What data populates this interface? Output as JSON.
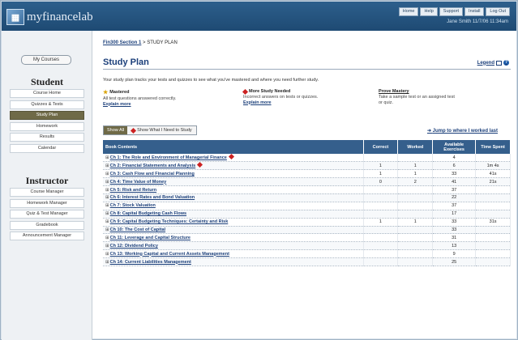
{
  "app": {
    "logo_text": "myfinancelab",
    "top_nav": [
      "Home",
      "Help",
      "Support",
      "Install",
      "Log Out"
    ],
    "user_line": "Jane Smith 11/7/06 11:34am"
  },
  "sidebar": {
    "my_courses": "My Courses",
    "student_heading": "Student",
    "student_items": [
      {
        "label": "Course Home",
        "active": false
      },
      {
        "label": "Quizzes & Tests",
        "active": false
      },
      {
        "label": "Study Plan",
        "active": true
      },
      {
        "label": "Homework",
        "active": false
      },
      {
        "label": "Results",
        "active": false
      },
      {
        "label": "Calendar",
        "active": false
      }
    ],
    "instructor_heading": "Instructor",
    "instructor_items": [
      {
        "label": "Course Manager"
      },
      {
        "label": "Homework Manager"
      },
      {
        "label": "Quiz & Test Manager"
      },
      {
        "label": "Gradebook"
      },
      {
        "label": "Announcement Manager"
      }
    ]
  },
  "breadcrumb": {
    "course": "Fin300 Section 1",
    "current": "STUDY PLAN"
  },
  "page_title": "Study Plan",
  "legend_label": "Legend",
  "intro": "Your study plan tracks your tests and quizzes to see what you've mastered and where you need further study.",
  "status": {
    "mastered": {
      "title": "Mastered",
      "body": "All test questions answered correctly.",
      "link": "Explain more"
    },
    "more_study": {
      "title": "More Study Needed",
      "body": "Incorrect answers on tests or quizzes.",
      "link": "Explain more"
    },
    "prove": {
      "title": "Prove Mastery",
      "body": "Take a sample test or an assigned test or quiz."
    }
  },
  "filter": {
    "show_all": "Show All",
    "show_need": "Show What I Need to Study"
  },
  "jump_link": "Jump to where I worked last",
  "table": {
    "headers": [
      "Book Contents",
      "Correct",
      "Worked",
      "Available Exercises",
      "Time Spent"
    ],
    "rows": [
      {
        "chapter": "Ch 1: The Role and Environment of Managerial Finance",
        "flag": true,
        "correct": "",
        "worked": "",
        "available": "4",
        "time": ""
      },
      {
        "chapter": "Ch 2: Financial Statements and Analysis",
        "flag": true,
        "correct": "1",
        "worked": "1",
        "available": "6",
        "time": "1m 4s"
      },
      {
        "chapter": "Ch 3: Cash Flow and Financial Planning",
        "flag": false,
        "correct": "1",
        "worked": "1",
        "available": "33",
        "time": "41s"
      },
      {
        "chapter": "Ch 4: Time Value of Money",
        "flag": false,
        "correct": "0",
        "worked": "2",
        "available": "41",
        "time": "21s"
      },
      {
        "chapter": "Ch 5: Risk and Return",
        "flag": false,
        "correct": "",
        "worked": "",
        "available": "37",
        "time": ""
      },
      {
        "chapter": "Ch 6: Interest Rates and Bond Valuation",
        "flag": false,
        "correct": "",
        "worked": "",
        "available": "22",
        "time": ""
      },
      {
        "chapter": "Ch 7: Stock Valuation",
        "flag": false,
        "correct": "",
        "worked": "",
        "available": "37",
        "time": ""
      },
      {
        "chapter": "Ch 8: Capital Budgeting Cash Flows",
        "flag": false,
        "correct": "",
        "worked": "",
        "available": "17",
        "time": ""
      },
      {
        "chapter": "Ch 9: Capital Budgeting Techniques: Certainty and Risk",
        "flag": false,
        "correct": "1",
        "worked": "1",
        "available": "33",
        "time": "31s"
      },
      {
        "chapter": "Ch 10: The Cost of Capital",
        "flag": false,
        "correct": "",
        "worked": "",
        "available": "33",
        "time": ""
      },
      {
        "chapter": "Ch 11: Leverage and Capital Structure",
        "flag": false,
        "correct": "",
        "worked": "",
        "available": "31",
        "time": ""
      },
      {
        "chapter": "Ch 12: Dividend Policy",
        "flag": false,
        "correct": "",
        "worked": "",
        "available": "13",
        "time": ""
      },
      {
        "chapter": "Ch 13: Working Capital and Current Assets Management",
        "flag": false,
        "correct": "",
        "worked": "",
        "available": "9",
        "time": ""
      },
      {
        "chapter": "Ch 14: Current Liabilities Management",
        "flag": false,
        "correct": "",
        "worked": "",
        "available": "25",
        "time": ""
      }
    ]
  }
}
